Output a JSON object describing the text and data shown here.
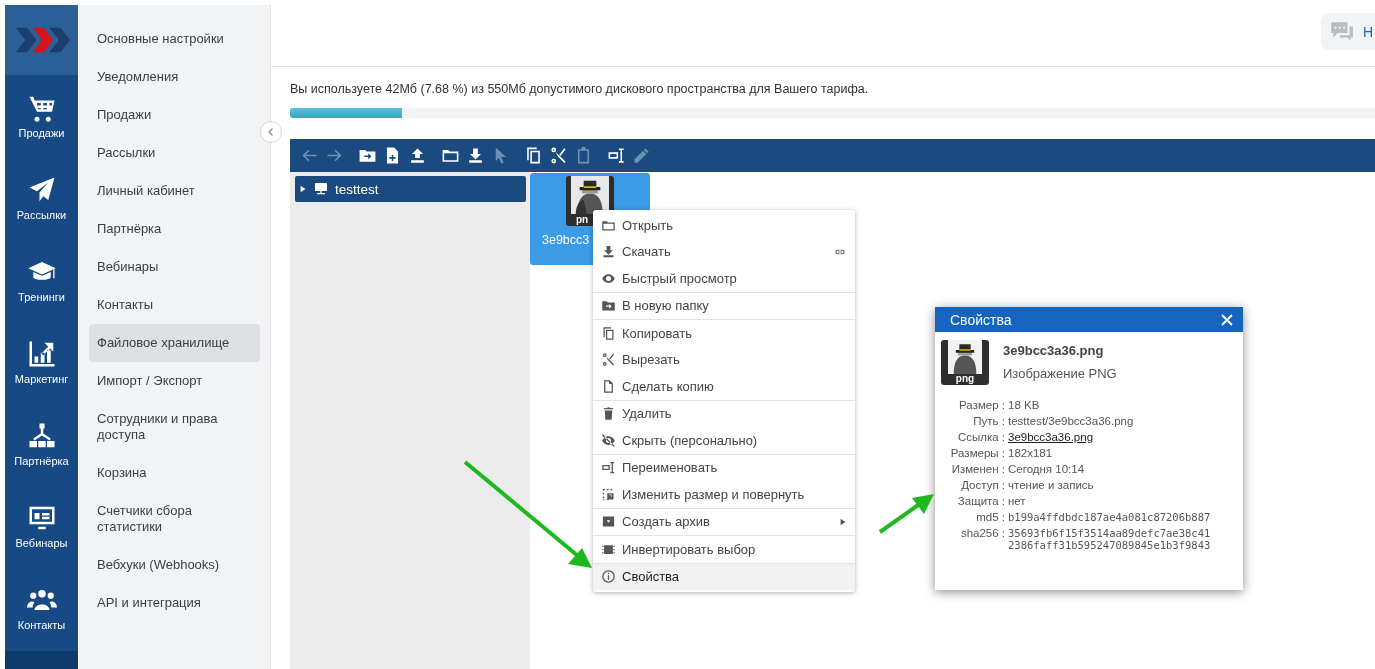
{
  "rail": {
    "items": [
      {
        "label": "Продажи",
        "selected": false
      },
      {
        "label": "Рассылки",
        "selected": false
      },
      {
        "label": "Тренинги",
        "selected": false
      },
      {
        "label": "Маркетинг",
        "selected": false
      },
      {
        "label": "Партнёрка",
        "selected": false
      },
      {
        "label": "Вебинары",
        "selected": false
      },
      {
        "label": "Контакты",
        "selected": false
      }
    ]
  },
  "settings_menu": {
    "items": [
      {
        "label": "Основные настройки",
        "selected": false
      },
      {
        "label": "Уведомления",
        "selected": false
      },
      {
        "label": "Продажи",
        "selected": false
      },
      {
        "label": "Рассылки",
        "selected": false
      },
      {
        "label": "Личный кабинет",
        "selected": false
      },
      {
        "label": "Партнёрка",
        "selected": false
      },
      {
        "label": "Вебинары",
        "selected": false
      },
      {
        "label": "Контакты",
        "selected": false
      },
      {
        "label": "Файловое хранилище",
        "selected": true
      },
      {
        "label": "Импорт / Экспорт",
        "selected": false
      },
      {
        "label": "Сотрудники и права доступа",
        "selected": false
      },
      {
        "label": "Корзина",
        "selected": false
      },
      {
        "label": "Счетчики сбора статистики",
        "selected": false
      },
      {
        "label": "Вебхуки (Webhooks)",
        "selected": false
      },
      {
        "label": "API и интеграция",
        "selected": false
      }
    ]
  },
  "header": {
    "help_button": "Н"
  },
  "storage": {
    "note": "Вы используете 42Мб (7.68 %) из 550Мб допустимого дискового пространства для Вашего тарифа.",
    "level": 0.103
  },
  "toolbar": {
    "groups": [
      [
        {
          "disabled": true
        },
        {
          "disabled": true
        }
      ],
      [
        {
          "disabled": false
        },
        {
          "disabled": false
        },
        {
          "disabled": false
        }
      ],
      [
        {
          "disabled": false
        },
        {
          "disabled": false
        },
        {
          "disabled": true
        }
      ],
      [
        {
          "disabled": false
        },
        {
          "disabled": false
        },
        {
          "disabled": true
        }
      ],
      [
        {
          "disabled": false
        },
        {
          "disabled": true
        }
      ]
    ]
  },
  "tree": [
    {
      "label": "testtest",
      "expanded": false,
      "selected": true
    }
  ],
  "files": [
    {
      "name": "3e9bcc3",
      "ext": "pn",
      "selected": true
    }
  ],
  "context_menu": {
    "groups": [
      [
        {
          "label": "Открыть",
          "selected": false
        },
        {
          "label": "Скачать",
          "link": true,
          "selected": false
        },
        {
          "label": "Быстрый просмотр",
          "selected": false
        }
      ],
      [
        {
          "label": "В новую папку",
          "selected": false
        }
      ],
      [
        {
          "label": "Копировать",
          "selected": false
        },
        {
          "label": "Вырезать",
          "selected": false
        },
        {
          "label": "Сделать копию",
          "selected": false
        }
      ],
      [
        {
          "label": "Удалить",
          "selected": false
        },
        {
          "label": "Скрыть (персонально)",
          "selected": false
        }
      ],
      [
        {
          "label": "Переименовать",
          "selected": false
        },
        {
          "label": "Изменить размер и повернуть",
          "selected": false
        }
      ],
      [
        {
          "label": "Создать архив",
          "submenu": true,
          "selected": false
        }
      ],
      [
        {
          "label": "Инвертировать выбор",
          "selected": false
        }
      ],
      [
        {
          "label": "Свойства",
          "selected": true
        }
      ]
    ]
  },
  "properties": {
    "title": "Свойства",
    "name": "3e9bcc3a36.png",
    "type": "Изображение PNG",
    "ext": "png",
    "rows": [
      {
        "label": "Размер :",
        "value": "18 KB",
        "kind": "text"
      },
      {
        "label": "Путь :",
        "value": "testtest/3e9bcc3a36.png",
        "kind": "text"
      },
      {
        "label": "Ссылка :",
        "value": "3e9bcc3a36.png",
        "kind": "link"
      },
      {
        "label": "Размеры :",
        "value": "182x181",
        "kind": "text"
      },
      {
        "label": "Изменен :",
        "value": "Сегодня 10:14",
        "kind": "text"
      },
      {
        "label": "Доступ :",
        "value": "чтение и запись",
        "kind": "text"
      },
      {
        "label": "Защита :",
        "value": "нет",
        "kind": "text"
      },
      {
        "label": "md5 :",
        "value": "b199a4ffdbdc187ae4a081c87206b887",
        "kind": "mono"
      },
      {
        "label": "sha256 :",
        "value": "35693fb6f15f3514aa89defc7ae38c412386faff31b595247089845e1b3f9843",
        "kind": "mono"
      }
    ]
  }
}
